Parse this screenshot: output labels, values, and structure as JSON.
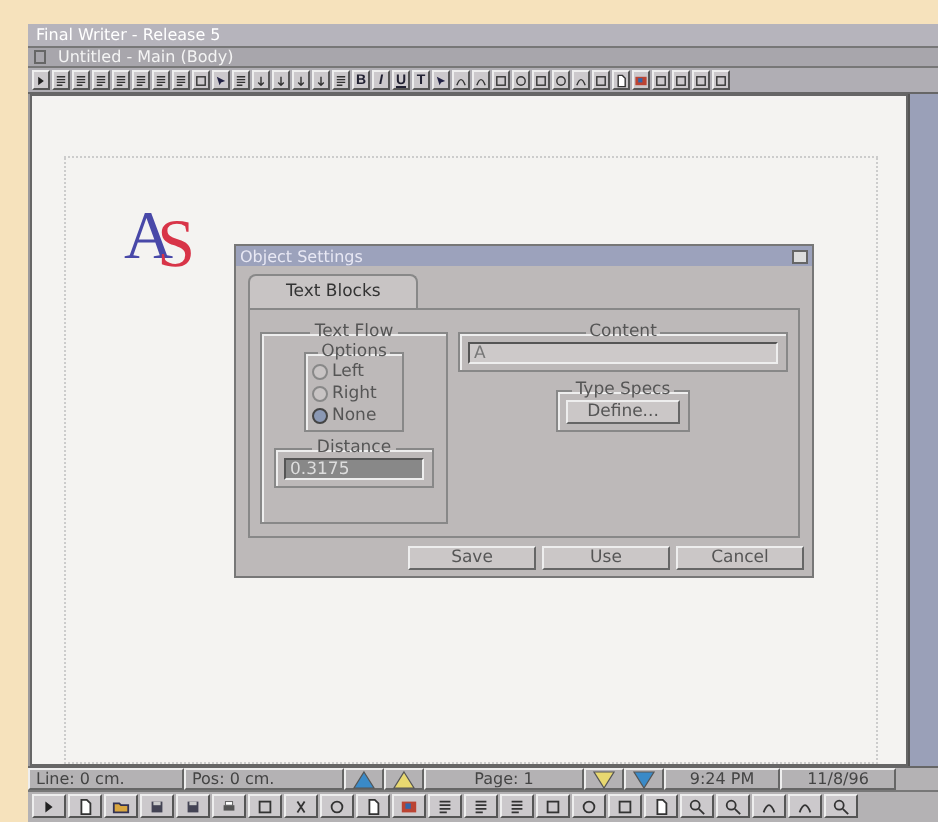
{
  "window": {
    "title": "Final Writer - Release 5"
  },
  "document_window": {
    "title": "Untitled - Main (Body)"
  },
  "toolbar": {
    "style_buttons": [
      "B",
      "I",
      "U",
      "T"
    ]
  },
  "document": {
    "logo": [
      {
        "text": "A",
        "color": "#4848a8"
      },
      {
        "text": "S",
        "color": "#d83448"
      }
    ]
  },
  "dialog": {
    "title": "Object Settings",
    "tabs": [
      {
        "label": "Text Blocks",
        "selected": true
      }
    ],
    "text_flow": {
      "title": "Text Flow",
      "options_title": "Options",
      "options": [
        {
          "label": "Left",
          "selected": false
        },
        {
          "label": "Right",
          "selected": false
        },
        {
          "label": "None",
          "selected": true
        }
      ],
      "distance_title": "Distance",
      "distance_value": "0.3175"
    },
    "content": {
      "title": "Content",
      "value": "A"
    },
    "type_specs": {
      "title": "Type Specs",
      "button": "Define..."
    },
    "buttons": [
      "Save",
      "Use",
      "Cancel"
    ]
  },
  "status_bar": {
    "line": "Line: 0 cm.",
    "pos": "Pos: 0 cm.",
    "page": "Page: 1",
    "time": "9:24 PM",
    "date": "11/8/96"
  }
}
